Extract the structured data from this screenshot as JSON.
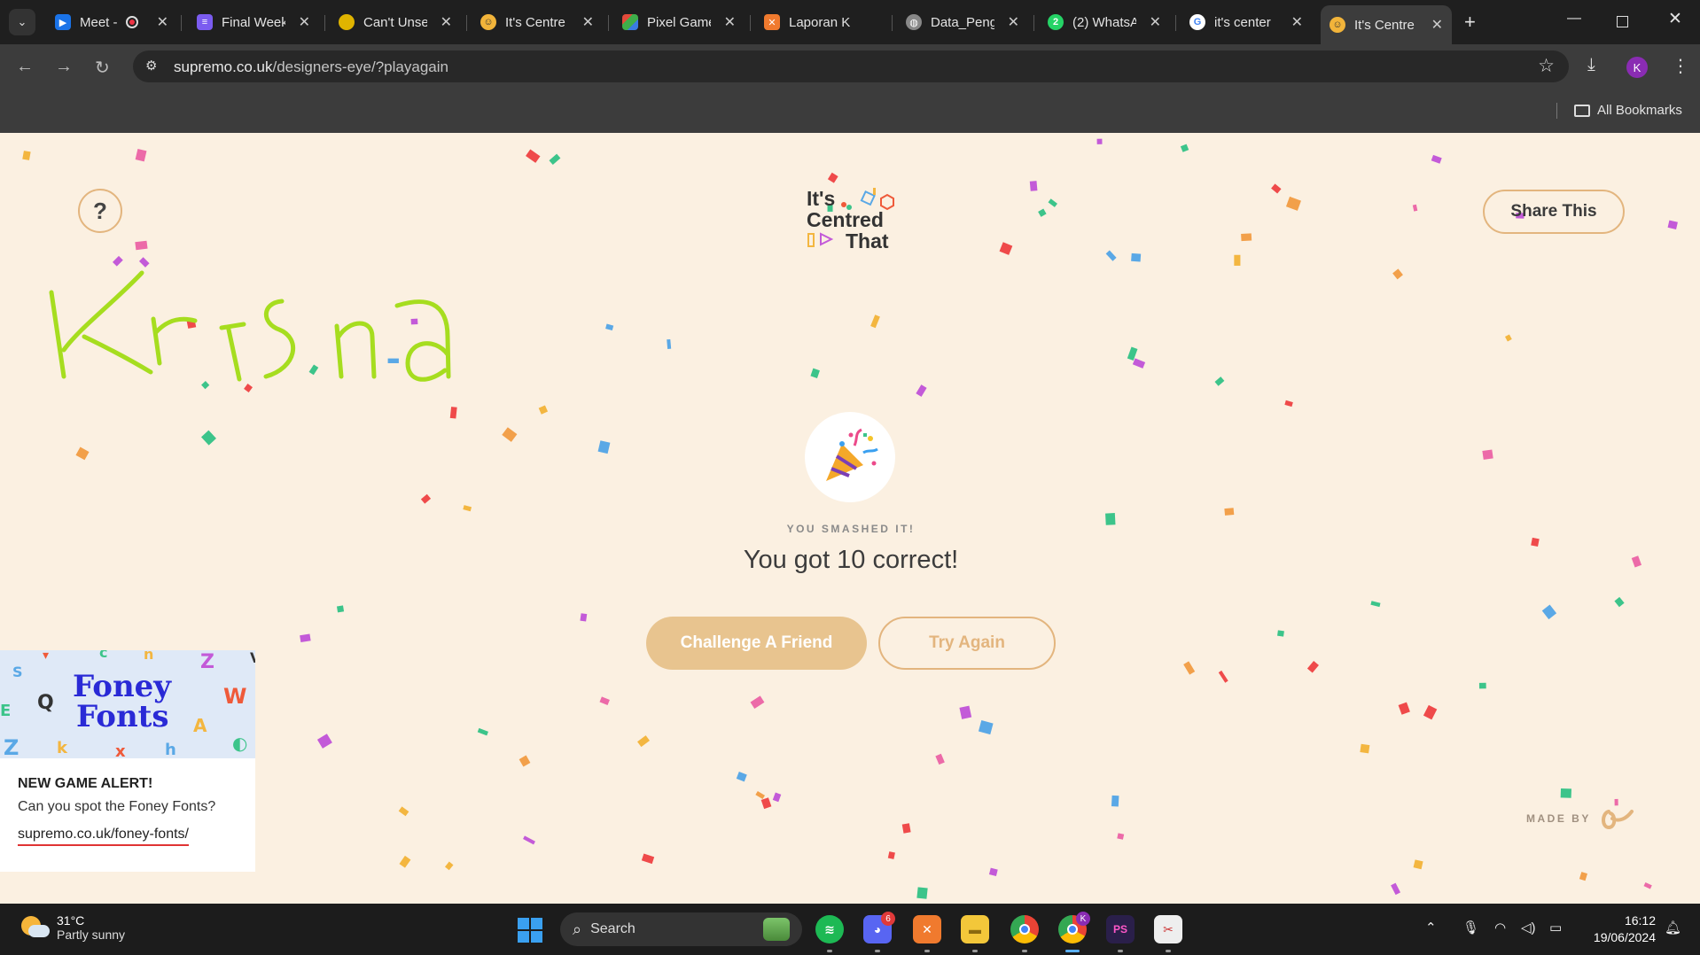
{
  "browser": {
    "tabs": [
      {
        "title": "Meet -",
        "icon": "google-meet-icon",
        "color": "#1a73e8",
        "recording": true
      },
      {
        "title": "Final Week",
        "icon": "list-icon",
        "color": "#7b5cf0"
      },
      {
        "title": "Can't Unse",
        "icon": "coin-icon",
        "color": "#e0b400"
      },
      {
        "title": "It's Centre",
        "icon": "smile-icon",
        "color": "#f2b43a"
      },
      {
        "title": "Pixel Game",
        "icon": "stripes-icon",
        "color": "#e24a3a"
      },
      {
        "title": "Laporan K",
        "icon": "xampp-icon",
        "color": "#f07a2e"
      },
      {
        "title": "Data_Peng",
        "icon": "globe-icon",
        "color": "#888888"
      },
      {
        "title": "(2) WhatsA",
        "icon": "whatsapp-icon",
        "color": "#25d366"
      },
      {
        "title": "it's center",
        "icon": "google-icon",
        "color": "#ffffff"
      },
      {
        "title": "It's Centre",
        "icon": "smile-icon",
        "color": "#f2b43a",
        "active": true
      }
    ],
    "url_host": "supremo.co.uk",
    "url_path": "/designers-eye/?playagain",
    "profile_initial": "K",
    "bookmarks_label": "All Bookmarks"
  },
  "page": {
    "help_label": "?",
    "logo": {
      "line1": "It's",
      "line2": "Centred",
      "line3": "That"
    },
    "share_label": "Share This",
    "handwriting": "Krisna",
    "result_kicker": "YOU SMASHED IT!",
    "result_text": "You got 10 correct!",
    "challenge_label": "Challenge A Friend",
    "try_again_label": "Try Again",
    "promo": {
      "art_title_1": "Foney",
      "art_title_2": "Fonts",
      "title": "NEW GAME ALERT!",
      "text": "Can you spot the Foney Fonts?",
      "link": "supremo.co.uk/foney-fonts/"
    },
    "made_by_label": "MADE BY",
    "colors": {
      "background": "#fbf0e1",
      "accent": "#e3b57e",
      "challenge": "#e8c48f"
    }
  },
  "taskbar": {
    "temperature": "31°C",
    "weather": "Partly sunny",
    "search_label": "Search",
    "discord_badge": "6",
    "time": "16:12",
    "date": "19/06/2024"
  }
}
